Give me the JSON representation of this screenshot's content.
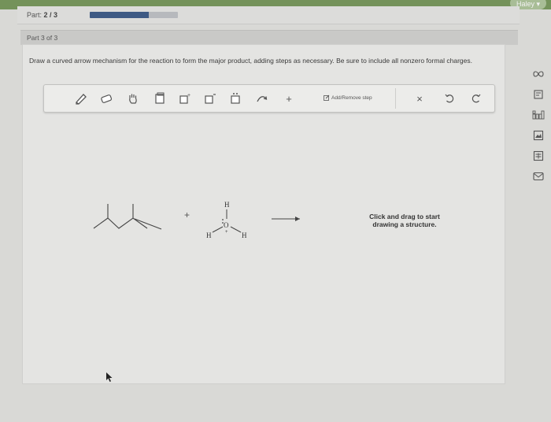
{
  "header": {
    "user": "Haley",
    "part_label": "Part:",
    "part_progress": "2 / 3",
    "progress_fraction": 0.67
  },
  "part": {
    "title": "Part 3 of 3"
  },
  "question": {
    "instructions": "Draw a curved arrow mechanism for the reaction to form the major product, adding steps as necessary. Be sure to include all nonzero formal charges."
  },
  "toolbar": {
    "plus_label": "+",
    "add_remove_label": "Add/Remove step",
    "close_label": "×"
  },
  "canvas": {
    "plus_sign": "+",
    "water": {
      "h_top": "H",
      "oxygen": "O",
      "charge": "+",
      "h_left": "H",
      "h_right": "H"
    },
    "hint_line1": "Click and drag to start",
    "hint_line2": "drawing a structure."
  },
  "sidebar": {
    "icons": [
      "infinity-icon",
      "book-icon",
      "periodic-table-icon",
      "image-icon",
      "calculator-icon",
      "mail-icon"
    ]
  },
  "colors": {
    "accent": "#3e5a84",
    "top_bar": "#74925a"
  }
}
